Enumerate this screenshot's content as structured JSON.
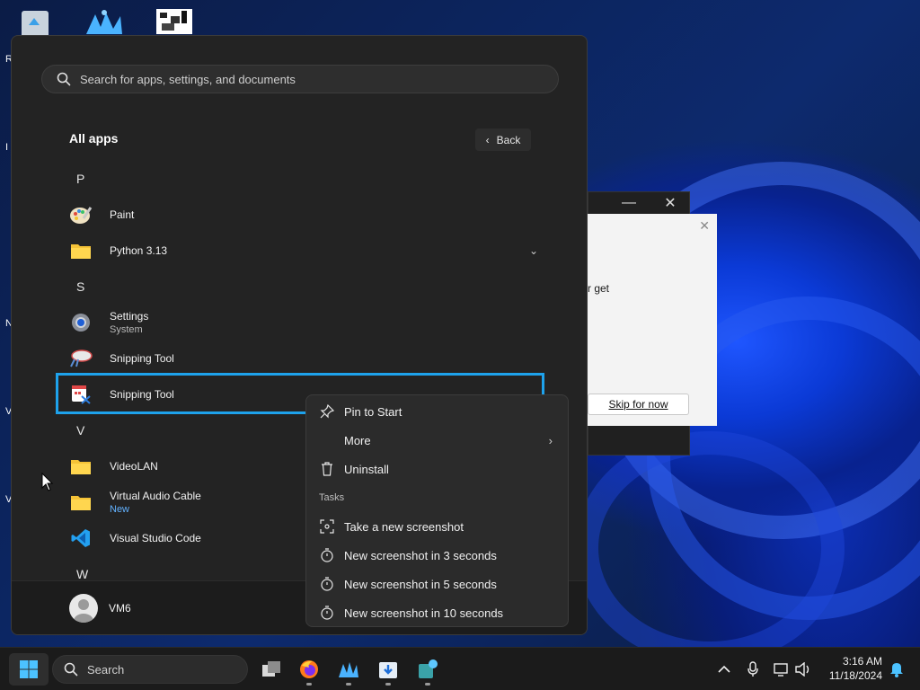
{
  "desktop": {
    "side_letters": [
      "R",
      "I",
      "N",
      "V",
      "V"
    ]
  },
  "background_window": {
    "minimize_glyph": "—",
    "close_glyph": "✕",
    "dialog_close_glyph": "✕",
    "partial_text": "r get",
    "skip_button_label": "Skip for now"
  },
  "start_menu": {
    "search_placeholder": "Search for apps, settings, and documents",
    "section_title": "All apps",
    "back_label": "Back",
    "groups": {
      "p": "P",
      "s": "S",
      "v": "V",
      "w": "W"
    },
    "apps": {
      "paint": {
        "name": "Paint"
      },
      "python": {
        "name": "Python 3.13"
      },
      "settings": {
        "name": "Settings",
        "sub": "System"
      },
      "snipping1": {
        "name": "Snipping Tool"
      },
      "snipping2": {
        "name": "Snipping Tool"
      },
      "videolan": {
        "name": "VideoLAN"
      },
      "vac": {
        "name": "Virtual Audio Cable",
        "sub": "New"
      },
      "vscode": {
        "name": "Visual Studio Code"
      }
    },
    "user_name": "VM6"
  },
  "context_menu": {
    "pin_to_start": "Pin to Start",
    "more": "More",
    "uninstall": "Uninstall",
    "tasks_header": "Tasks",
    "take_screenshot": "Take a new screenshot",
    "shot_3": "New screenshot in 3 seconds",
    "shot_5": "New screenshot in 5 seconds",
    "shot_10": "New screenshot in 10 seconds"
  },
  "taskbar": {
    "search_label": "Search",
    "time": "3:16 AM",
    "date": "11/18/2024"
  },
  "colors": {
    "accent": "#1ea2ec",
    "menu_bg": "#232323",
    "context_bg": "#2b2b2b",
    "taskbar_bg": "#1b1b1b"
  }
}
